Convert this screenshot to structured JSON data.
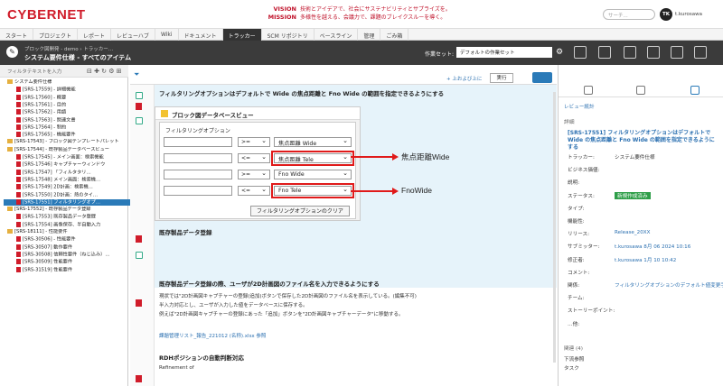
{
  "header": {
    "logo": "CYBERNET",
    "vision_label": "VISION",
    "mission_label": "MISSION",
    "vision_text": "技術とアイデアで、社会にサステナビリティとサプライズを。",
    "mission_text": "多様性を越える、会議力で、課題のブレイクスルーを導く。",
    "search_placeholder": "サーチ...",
    "avatar_initials": "TK",
    "username": "t.kurosawa"
  },
  "tabs": [
    {
      "label": "スタート"
    },
    {
      "label": "プロジェクト"
    },
    {
      "label": "レポート"
    },
    {
      "label": "レビューハブ"
    },
    {
      "label": "Wiki"
    },
    {
      "label": "ドキュメント"
    },
    {
      "label": "トラッカー"
    },
    {
      "label": "SCM リポジトリ"
    },
    {
      "label": "ベースライン"
    },
    {
      "label": "管理"
    },
    {
      "label": "ごみ箱"
    }
  ],
  "toolbar": {
    "breadcrumb": "ブロック図開発 - demo › トラッカー…",
    "title": "システム要件仕様 - すべてのアイテム",
    "workset_label": "作業セット:",
    "workset_value": "デフォルトの作業セット"
  },
  "left": {
    "filter_placeholder": "フィルタテキストを入力",
    "tree": [
      {
        "label": "システム要件仕様",
        "icon": "folder"
      },
      {
        "label": "[SRS-17559] - 詳細機能",
        "icon": "req"
      },
      {
        "label": "[SRS-17560] - 概要",
        "icon": "req"
      },
      {
        "label": "[SRS-17561] - 目的",
        "icon": "req"
      },
      {
        "label": "[SRS-17562] - 用語",
        "icon": "req"
      },
      {
        "label": "[SRS-17563] - 関連文書",
        "icon": "req"
      },
      {
        "label": "[SRS-17564] - 制約",
        "icon": "req"
      },
      {
        "label": "[SRS-17565] - 機能要件",
        "icon": "req"
      },
      {
        "label": "[SRS-17543] - ブロック図テンプレートパレット",
        "icon": "folder"
      },
      {
        "label": "[SRS-17544] - 既存製品データベースビュー",
        "icon": "folder"
      },
      {
        "label": "[SRS-17545] - メイン画面：検索機能",
        "icon": "req"
      },
      {
        "label": "[SRS-17546] キャプチャーウィンドウ",
        "icon": "req"
      },
      {
        "label": "[SRS-17547] 「フィルタタリ…",
        "icon": "req"
      },
      {
        "label": "[SRS-17548] メイン画面：検索機…",
        "icon": "req"
      },
      {
        "label": "[SRS-17549] 2D計画：検索機…",
        "icon": "req"
      },
      {
        "label": "[SRS-17550] 2D計画：熱のタイ…",
        "icon": "req"
      },
      {
        "label": "[SRS-17551] フィルタリングオプ…",
        "icon": "req",
        "selected": true
      },
      {
        "label": "[SRS-17552] - 既存製品データ登録",
        "icon": "folder"
      },
      {
        "label": "[SRS-17553] 既存製品データ登録",
        "icon": "req"
      },
      {
        "label": "[SRS-17554] 画像保存、半自動入力",
        "icon": "req"
      },
      {
        "label": "[SRS-18111] - 性能要件",
        "icon": "folder"
      },
      {
        "label": "[SRS-30506] - 性能要件",
        "icon": "req"
      },
      {
        "label": "[SRS-30507] 動作要件",
        "icon": "req"
      },
      {
        "label": "[SRS-30508] 信頼性要件（ねじ込み）…",
        "icon": "req"
      },
      {
        "label": "[SRS-30509] 性能要件",
        "icon": "req"
      },
      {
        "label": "[SRS-31519] 性能要件",
        "icon": "req"
      }
    ]
  },
  "middle": {
    "add_link": "+ 上および上に",
    "exec_label": "実行",
    "heading1": "フィルタリングオプションはデフォルトで Wide の焦点距離と Fno Wide の範囲を指定できるようにする",
    "widget_title": "ブロック図データベースビュー",
    "filter_label": "フィルタリングオプション",
    "filter_rows": [
      {
        "op": ">=",
        "value": "焦点距離 Wide",
        "highlight": false
      },
      {
        "op": "<=",
        "value": "焦点距離 Tele",
        "highlight": true
      },
      {
        "op": ">=",
        "value": "Fno Wide",
        "highlight": false
      },
      {
        "op": "<=",
        "value": "Fno Tele",
        "highlight": true
      }
    ],
    "clear_button": "フィルタリングオプションのクリア",
    "annot1": "焦点距離Wide",
    "annot2": "FnoWide",
    "heading2": "既存製品データ登録",
    "heading3": "既存製品データ登録の際、ユーザが2D計画図のファイル名を入力できるようにする",
    "para1": "現状では\"2D計画図キャプチャーの登録(追加)ボタンで保存した2D計画図のファイル名を表示している。(編集不可)",
    "para2": "半入力対応とし、ユーザが入力した値をデータベースに保存する。",
    "para3": "例えば\"2D計画図キャプチャーの登録にあった「追加」ボタンを\"2D計画図キャプチャーデータ\"に移動する。",
    "link1": "課題管理リスト_報告_221012 (名称).xlsx 参照",
    "heading4": "RDHポジションの自動判断対応",
    "para4": "Refinement of"
  },
  "right": {
    "review_link": "レビュー統計",
    "section_details": "詳細",
    "item_title": "[SRS-17551] フィルタリングオプションはデフォルトで Wide の焦点距離と Fno Wide の範囲を指定できるようにする",
    "fields": [
      {
        "label": "トラッカー:",
        "value": "システム要件仕様"
      },
      {
        "label": "ビジネス価値:",
        "value": ""
      },
      {
        "label": "説明:",
        "value": ""
      },
      {
        "label": "ステータス:",
        "value": "新規作成済み"
      },
      {
        "label": "タイプ:",
        "value": ""
      },
      {
        "label": "機能性:",
        "value": ""
      },
      {
        "label": "リリース:",
        "value": "Release_20XX"
      },
      {
        "label": "サブミッター:",
        "value": "t.kurosawa 8月 06 2024 10:16"
      },
      {
        "label": "修正者:",
        "value": "t.kurosawa 1月 10 10:42"
      },
      {
        "label": "コメント:",
        "value": ""
      },
      {
        "label": "関係:",
        "value": "フィルタリングオプションのデフォルト値変更手順"
      },
      {
        "label": "チーム:",
        "value": ""
      },
      {
        "label": "ストーリーポイント:",
        "value": ""
      },
      {
        "label": "…他:",
        "value": ""
      }
    ],
    "section_related": "関連 (4)",
    "related_label": "下流参照",
    "task_label": "タスク"
  },
  "colors": {
    "brand_red": "#d01c2a",
    "accent_blue": "#2a7ab8",
    "status_green": "#2e9e48"
  }
}
